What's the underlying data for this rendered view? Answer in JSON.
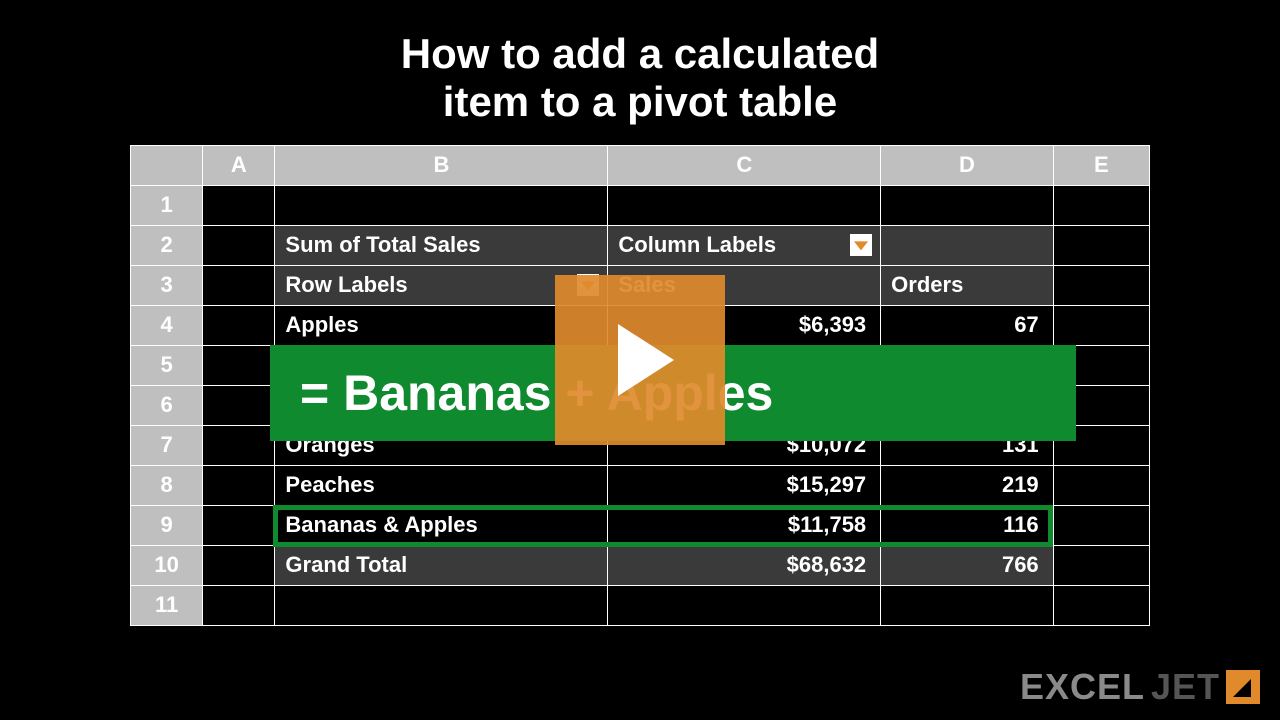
{
  "title_line1": "How to add a calculated",
  "title_line2": "item to a pivot table",
  "columns": {
    "a": "A",
    "b": "B",
    "c": "C",
    "d": "D",
    "e": "E"
  },
  "rows": [
    "1",
    "2",
    "3",
    "4",
    "5",
    "6",
    "7",
    "8",
    "9",
    "10",
    "11"
  ],
  "pivot": {
    "sum_label": "Sum of Total Sales",
    "col_labels": "Column Labels",
    "row_labels": "Row Labels",
    "col_sales": "Sales",
    "col_orders": "Orders",
    "items": [
      {
        "name": "Apples",
        "sales": "$6,393",
        "orders": "67"
      },
      {
        "name": "",
        "sales": "",
        "orders": ""
      },
      {
        "name": "",
        "sales": "",
        "orders": ""
      },
      {
        "name": "Oranges",
        "sales": "$10,072",
        "orders": "131"
      },
      {
        "name": "Peaches",
        "sales": "$15,297",
        "orders": "219"
      },
      {
        "name": "Bananas & Apples",
        "sales": "$11,758",
        "orders": "116"
      }
    ],
    "grand_label": "Grand Total",
    "grand_sales": "$68,632",
    "grand_orders": "766"
  },
  "formula": "=  Bananas  +  Apples",
  "logo": {
    "part1": "EXCEL",
    "part2": "JET"
  }
}
